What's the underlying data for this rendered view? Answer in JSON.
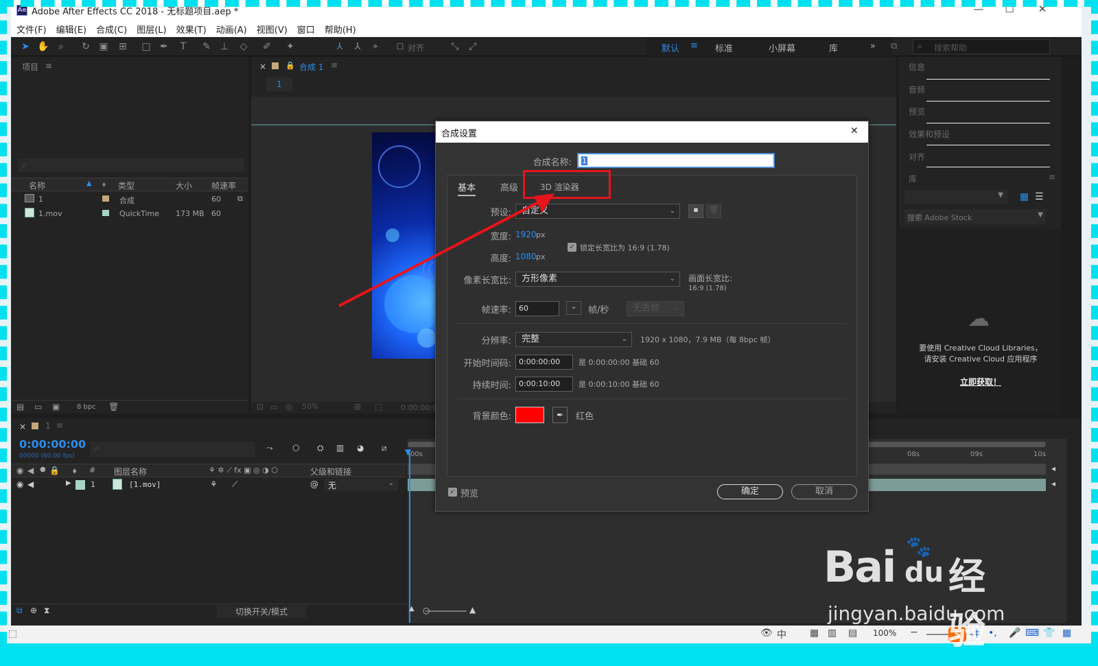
{
  "window": {
    "title": "Adobe After Effects CC 2018 - 无标题项目.aep *",
    "logo_text": "Ae",
    "minimize": "—",
    "maximize": "☐",
    "close": "✕"
  },
  "menu": [
    "文件(F)",
    "编辑(E)",
    "合成(C)",
    "图层(L)",
    "效果(T)",
    "动画(A)",
    "视图(V)",
    "窗口",
    "帮助(H)"
  ],
  "toolbar": {
    "align_label": "对齐",
    "workspaces": [
      "默认",
      "标准",
      "小屏幕",
      "库"
    ],
    "overflow": "»",
    "search_placeholder": "搜索帮助"
  },
  "project_panel": {
    "title": "项目",
    "columns": [
      "名称",
      "类型",
      "大小",
      "帧速率"
    ],
    "items": [
      {
        "name": "1",
        "type": "合成",
        "size": "",
        "fps": "60",
        "swatch": "#c4a77a"
      },
      {
        "name": "1.mov",
        "type": "QuickTime",
        "size": "173 MB",
        "fps": "60",
        "swatch": "#a8d4c8"
      }
    ],
    "bpc": "8 bpc"
  },
  "comp_panel": {
    "tab_label": "合成 1",
    "sub_tab": "1",
    "zoom": "50%",
    "timecode": "0:00:00:00"
  },
  "right_panels": {
    "items": [
      "信息",
      "音频",
      "预览",
      "效果和预设",
      "对齐",
      "库"
    ],
    "stock_search_placeholder": "搜索 Adobe Stock",
    "cc_message_line1": "要使用 Creative Cloud Libraries，",
    "cc_message_line2": "请安装 Creative Cloud 应用程序",
    "cc_link": "立即获取！"
  },
  "timeline": {
    "tab_label": "1",
    "timecode": "0:00:00:00",
    "frame_info": "00000 (60.00 fps)",
    "col_layer_name": "图层名称",
    "col_parent": "父级和链接",
    "col_num": "#",
    "layer": {
      "index": "1",
      "name": "[1.mov]",
      "parent": "无"
    },
    "ruler_labels": [
      "00s",
      "08s",
      "09s",
      "10s"
    ],
    "toggle_label": "切换开关/模式"
  },
  "dialog": {
    "title": "合成设置",
    "close": "✕",
    "comp_name_label": "合成名称:",
    "comp_name_value": "1",
    "tabs": [
      "基本",
      "高级",
      "3D 渲染器"
    ],
    "preset_label": "预设:",
    "preset_value": "自定义",
    "width_label": "宽度:",
    "width_value": "1920",
    "height_label": "高度:",
    "height_value": "1080",
    "px_unit": "px",
    "lock_aspect_label": "锁定长宽比为 16:9 (1.78)",
    "pixel_aspect_label": "像素长宽比:",
    "pixel_aspect_value": "方形像素",
    "frame_aspect_label": "画面长宽比:",
    "frame_aspect_value": "16:9 (1.78)",
    "fps_label": "帧速率:",
    "fps_value": "60",
    "fps_unit": "帧/秒",
    "drop_frame_value": "无丢帧",
    "resolution_label": "分辨率:",
    "resolution_value": "完整",
    "resolution_info": "1920 x 1080，7.9 MB（每 8bpc 帧）",
    "start_tc_label": "开始时间码:",
    "start_tc_value": "0:00:00:00",
    "start_tc_info": "是 0:00:00:00  基础 60",
    "duration_label": "持续时间:",
    "duration_value": "0:00:10:00",
    "duration_info": "是 0:00:10:00  基础 60",
    "bg_color_label": "背景颜色:",
    "bg_color_name": "红色",
    "bg_color_hex": "#ff0000",
    "preview_label": "预览",
    "ok_label": "确定",
    "cancel_label": "取消"
  },
  "status_bar": {
    "zoom": "100%",
    "ime_text": "中"
  },
  "watermark": {
    "brand": "Bai",
    "du": "du",
    "cn": "经验",
    "url": "jingyan.baidu.com"
  },
  "colors": {
    "accent_blue": "#2d8ceb",
    "annotation_red": "#e8141b",
    "border_cyan": "#00e0ee"
  }
}
